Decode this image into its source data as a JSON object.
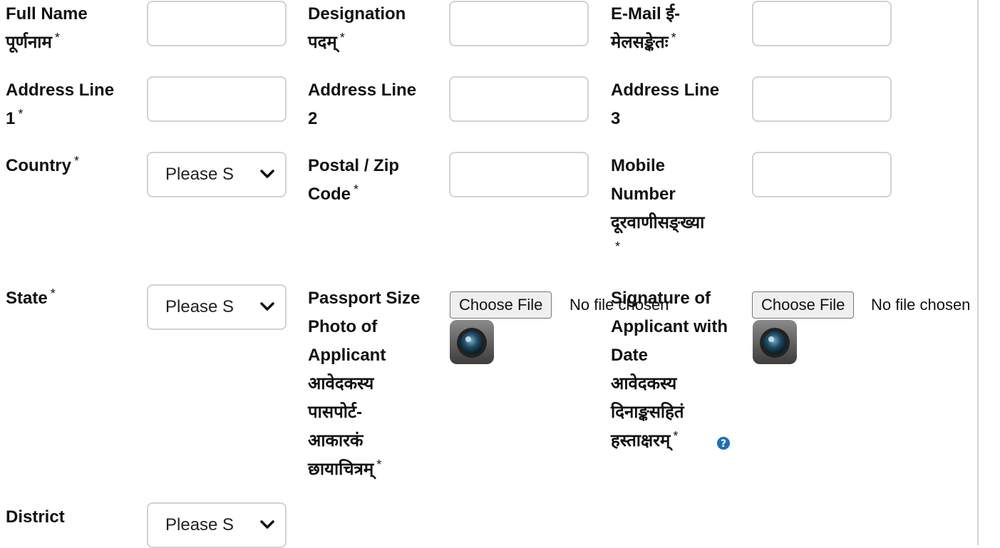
{
  "form": {
    "req_mark": "*",
    "full_name": {
      "label": "Full Name\nपूर्णनाम"
    },
    "designation": {
      "label": "Designation\nपदम्"
    },
    "email": {
      "label": "E-Mail ई-\nमेलसङ्केतः"
    },
    "address1": {
      "label": "Address Line\n1"
    },
    "address2": {
      "label": "Address Line\n2"
    },
    "address3": {
      "label": "Address Line\n3"
    },
    "country": {
      "label": "Country",
      "select_value": "Please S"
    },
    "postal": {
      "label": "Postal / Zip\nCode"
    },
    "mobile": {
      "label": "Mobile\nNumber\nदूरवाणीसङ्ख्या"
    },
    "state": {
      "label": "State",
      "select_value": "Please S"
    },
    "photo": {
      "label": "Passport Size\nPhoto of\nApplicant\nआवेदकस्य\nपासपोर्ट-\nआकारकं\nछायाचित्रम्",
      "button": "Choose File",
      "status": "No file chosen"
    },
    "signature": {
      "label": "Signature of\nApplicant with\nDate\nआवेदकस्य\nदिनाङ्कसहितं\nहस्ताक्षरम्",
      "button": "Choose File",
      "status": "No file chosen"
    },
    "district": {
      "label": "District",
      "select_value": "Please S"
    }
  },
  "icons": {
    "camera": "camera-icon",
    "help": "help-icon",
    "chevron": "chevron-down-icon"
  },
  "colors": {
    "border": "#d2d2d2",
    "help_blue": "#1f6fb5",
    "divider": "#d4d4d4"
  }
}
